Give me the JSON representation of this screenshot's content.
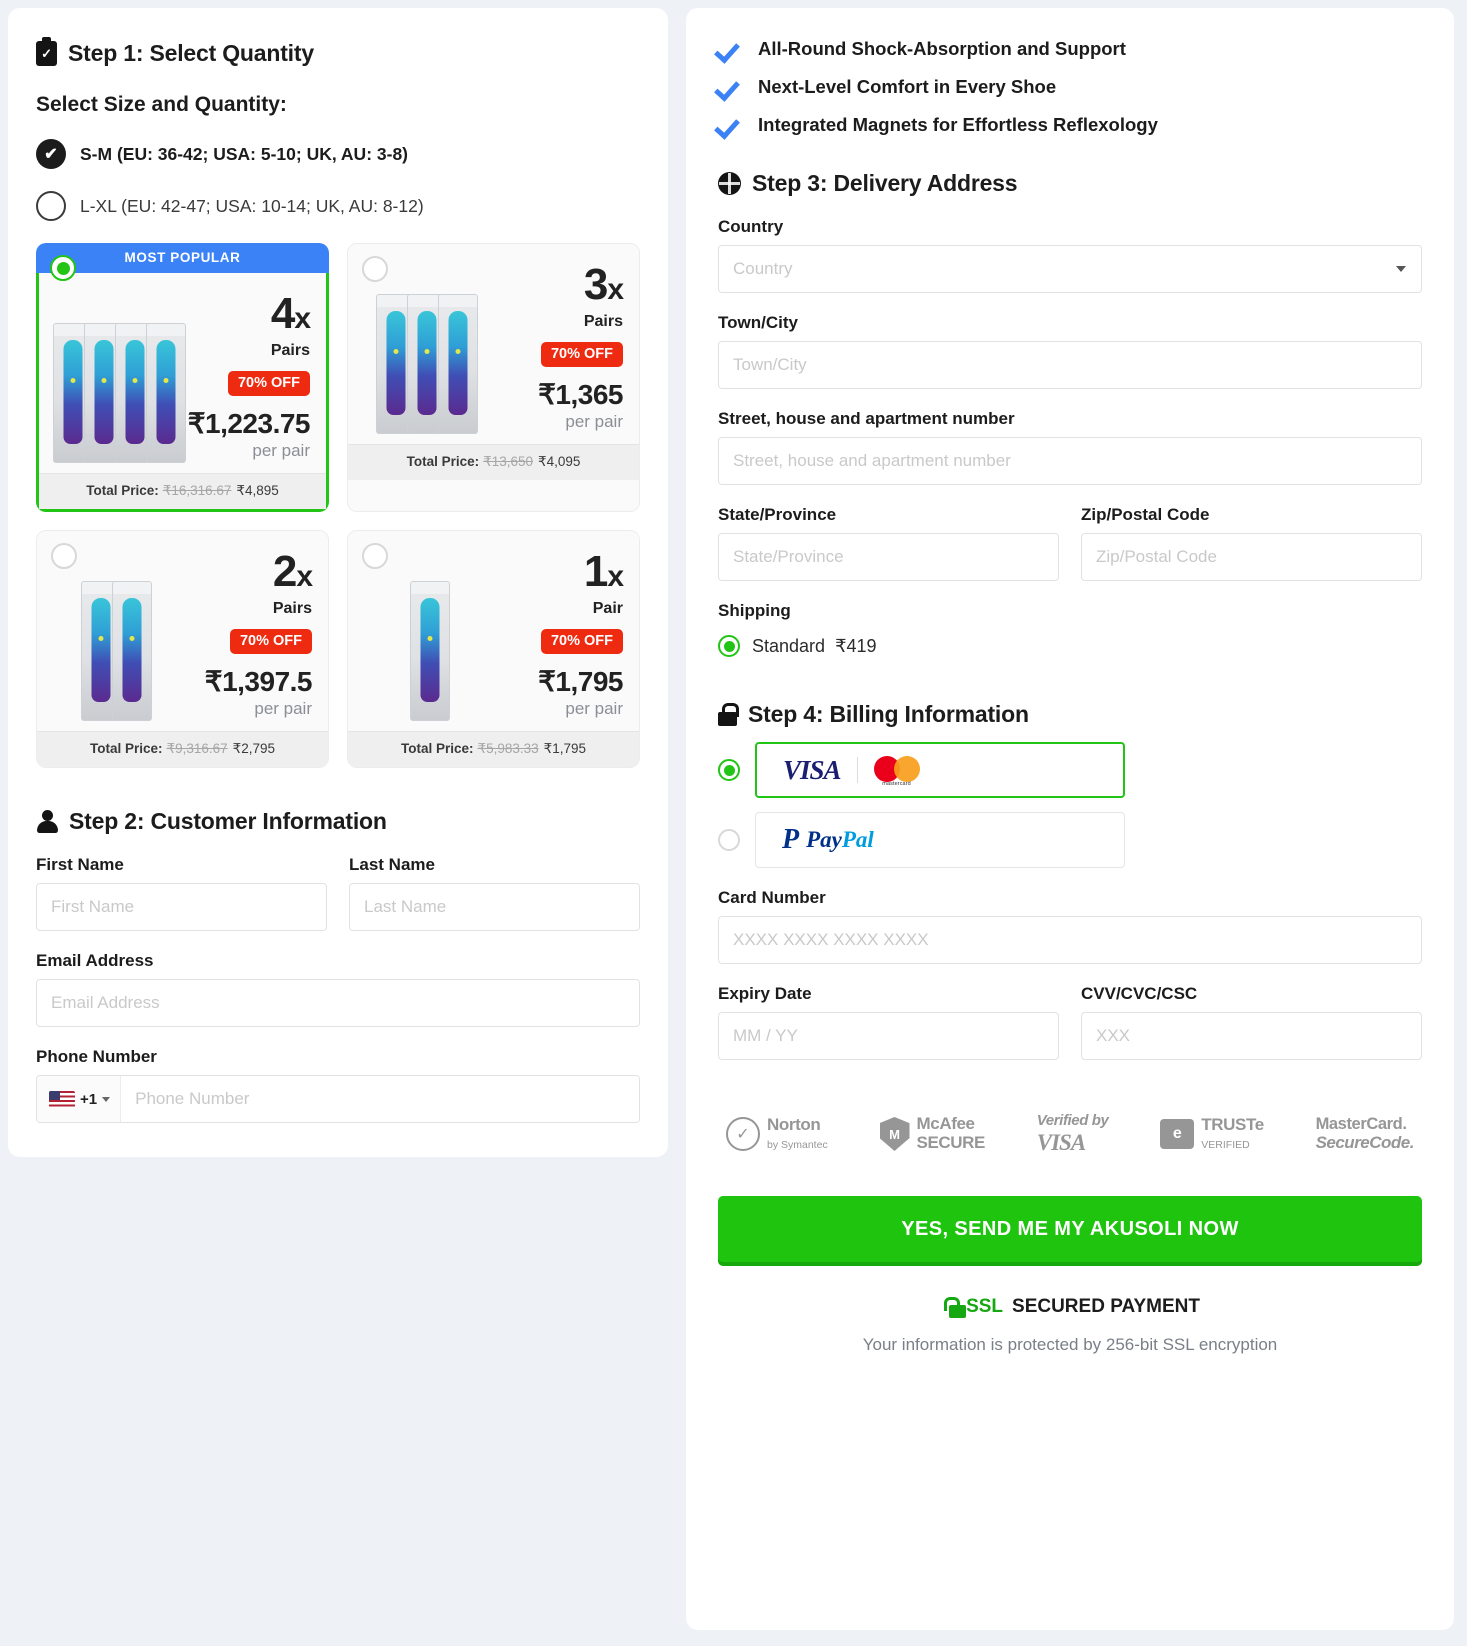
{
  "left": {
    "step1_title": "Step 1: Select Quantity",
    "size_section_label": "Select Size and Quantity:",
    "sizes": [
      {
        "label": "S-M (EU: 36-42; USA: 5-10; UK, AU: 3-8)",
        "selected": true
      },
      {
        "label": "L-XL (EU: 42-47; USA: 10-14; UK, AU: 8-12)",
        "selected": false
      }
    ],
    "ribbon_label": "MOST POPULAR",
    "offers": [
      {
        "qty": "4",
        "x": "x",
        "unit_label": "Pairs",
        "discount": "70% OFF",
        "price": "₹1,223.75",
        "per": "per pair",
        "total_label": "Total Price:",
        "total_old": "₹16,316.67",
        "total_new": "₹4,895",
        "packs": 4,
        "selected": true,
        "ribbon": true
      },
      {
        "qty": "3",
        "x": "x",
        "unit_label": "Pairs",
        "discount": "70% OFF",
        "price": "₹1,365",
        "per": "per pair",
        "total_label": "Total Price:",
        "total_old": "₹13,650",
        "total_new": "₹4,095",
        "packs": 3,
        "selected": false,
        "ribbon": false
      },
      {
        "qty": "2",
        "x": "x",
        "unit_label": "Pairs",
        "discount": "70% OFF",
        "price": "₹1,397.5",
        "per": "per pair",
        "total_label": "Total Price:",
        "total_old": "₹9,316.67",
        "total_new": "₹2,795",
        "packs": 2,
        "selected": false,
        "ribbon": false
      },
      {
        "qty": "1",
        "x": "x",
        "unit_label": "Pair",
        "discount": "70% OFF",
        "price": "₹1,795",
        "per": "per pair",
        "total_label": "Total Price:",
        "total_old": "₹5,983.33",
        "total_new": "₹1,795",
        "packs": 1,
        "selected": false,
        "ribbon": false
      }
    ],
    "step2_title": "Step 2: Customer Information",
    "first_name_label": "First Name",
    "first_name_placeholder": "First Name",
    "first_name_value": "",
    "last_name_label": "Last Name",
    "last_name_placeholder": "Last Name",
    "last_name_value": "",
    "email_label": "Email Address",
    "email_placeholder": "Email Address",
    "email_value": "",
    "phone_label": "Phone Number",
    "phone_placeholder": "Phone Number",
    "phone_value": "",
    "phone_country_code": "+1",
    "phone_flag": "us-flag-icon"
  },
  "right": {
    "bullets": [
      "All-Round Shock-Absorption and Support",
      "Next-Level Comfort in Every Shoe",
      "Integrated Magnets for Effortless Reflexology"
    ],
    "step3_title": "Step 3: Delivery Address",
    "country_label": "Country",
    "country_placeholder": "Country",
    "country_value": "",
    "city_label": "Town/City",
    "city_placeholder": "Town/City",
    "city_value": "",
    "street_label": "Street, house and apartment number",
    "street_placeholder": "Street, house and apartment number",
    "street_value": "",
    "state_label": "State/Province",
    "state_placeholder": "State/Province",
    "state_value": "",
    "zip_label": "Zip/Postal Code",
    "zip_placeholder": "Zip/Postal Code",
    "zip_value": "",
    "shipping_label": "Shipping",
    "shipping_option": "Standard",
    "shipping_price": "₹419",
    "step4_title": "Step 4: Billing Information",
    "pm_card_visa": "VISA",
    "pm_card_mastercard": "mastercard",
    "pm_paypal_a": "Pay",
    "pm_paypal_b": "Pal",
    "card_number_label": "Card Number",
    "card_number_placeholder": "XXXX XXXX XXXX XXXX",
    "card_number_value": "",
    "expiry_label": "Expiry Date",
    "expiry_placeholder": "MM / YY",
    "expiry_value": "",
    "cvv_label": "CVV/CVC/CSC",
    "cvv_placeholder": "XXX",
    "cvv_value": "",
    "trust": {
      "norton_1": "Norton",
      "norton_2": "by Symantec",
      "mcafee_1": "McAfee",
      "mcafee_2": "SECURE",
      "vbv_1": "Verified by",
      "vbv_2": "VISA",
      "truste_1": "TRUSTe",
      "truste_2": "VERIFIED",
      "mcsc_1": "MasterCard.",
      "mcsc_2": "SecureCode."
    },
    "cta_label": "YES, SEND ME MY AKUSOLI NOW",
    "ssl_green": "SSL",
    "ssl_rest": "SECURED PAYMENT",
    "ssl_sub": "Your information is protected by 256-bit SSL encryption"
  },
  "colors": {
    "accent_green": "#22c516",
    "cta_green": "#1fc40f",
    "ribbon_blue": "#3b82f6",
    "discount_red": "#ee2a11"
  }
}
